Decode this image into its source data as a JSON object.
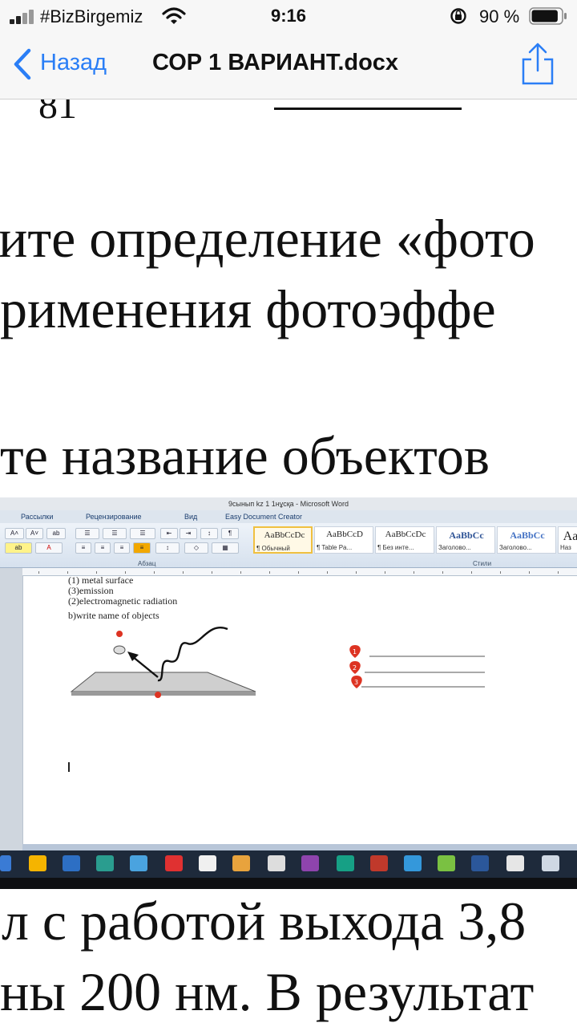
{
  "status_bar": {
    "carrier": "#BizBirgemiz",
    "time": "9:16",
    "battery_percent": "90 %",
    "battery_level": 0.9
  },
  "nav": {
    "back_label": "Назад",
    "title": "СОР 1 ВАРИАНТ.docx"
  },
  "document": {
    "cut_top_text": "81",
    "lines": [
      "ите определение «фото",
      "рименения фотоэффе",
      "те название объектов",
      "л с работой выхода 3,8",
      "ны 200 нм. В результат"
    ]
  },
  "photo": {
    "window_title": "9сынып kz 1 1нұсқа  -  Microsoft Word",
    "tabs": [
      "Рассылки",
      "Рецензирование",
      "Вид",
      "Easy Document Creator"
    ],
    "styles": [
      {
        "sample": "AaBbCcDc",
        "name": "¶ Обычный"
      },
      {
        "sample": "AaBbCcD",
        "name": "¶ Table Pa..."
      },
      {
        "sample": "AaBbCcDc",
        "name": "¶ Без инте..."
      },
      {
        "sample": "AaBbCc",
        "name": "Заголово..."
      },
      {
        "sample": "AaBbCc",
        "name": "Заголово..."
      },
      {
        "sample": "Aa",
        "name": "Наз"
      }
    ],
    "group_labels": {
      "paragraph": "Абзац",
      "styles": "Стили"
    },
    "sheet": {
      "items": [
        "(1) metal surface",
        "(3)emission",
        "(2)electromagnetic radiation"
      ],
      "task": "b)write name of objects",
      "markers": [
        "1",
        "2",
        "3"
      ]
    }
  }
}
